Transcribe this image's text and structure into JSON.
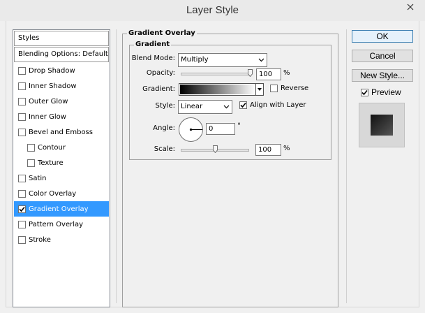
{
  "window": {
    "title": "Layer Style"
  },
  "styles_panel": {
    "header": "Styles",
    "blending_options": "Blending Options: Default",
    "items": [
      {
        "label": "Drop Shadow",
        "checked": false,
        "indent": false,
        "selected": false
      },
      {
        "label": "Inner Shadow",
        "checked": false,
        "indent": false,
        "selected": false
      },
      {
        "label": "Outer Glow",
        "checked": false,
        "indent": false,
        "selected": false
      },
      {
        "label": "Inner Glow",
        "checked": false,
        "indent": false,
        "selected": false
      },
      {
        "label": "Bevel and Emboss",
        "checked": false,
        "indent": false,
        "selected": false
      },
      {
        "label": "Contour",
        "checked": false,
        "indent": true,
        "selected": false
      },
      {
        "label": "Texture",
        "checked": false,
        "indent": true,
        "selected": false
      },
      {
        "label": "Satin",
        "checked": false,
        "indent": false,
        "selected": false
      },
      {
        "label": "Color Overlay",
        "checked": false,
        "indent": false,
        "selected": false
      },
      {
        "label": "Gradient Overlay",
        "checked": true,
        "indent": false,
        "selected": true
      },
      {
        "label": "Pattern Overlay",
        "checked": false,
        "indent": false,
        "selected": false
      },
      {
        "label": "Stroke",
        "checked": false,
        "indent": false,
        "selected": false
      }
    ]
  },
  "gradient_overlay": {
    "section_title": "Gradient Overlay",
    "group_title": "Gradient",
    "blend_mode_label": "Blend Mode:",
    "blend_mode_value": "Multiply",
    "opacity_label": "Opacity:",
    "opacity_value": "100",
    "opacity_level": 1.0,
    "percent_sign": "%",
    "gradient_label": "Gradient:",
    "gradient_colors": [
      "#000000",
      "#ffffff"
    ],
    "reverse_label": "Reverse",
    "reverse_checked": false,
    "style_label": "Style:",
    "style_value": "Linear",
    "align_label": "Align with Layer",
    "align_checked": true,
    "angle_label": "Angle:",
    "angle_value": "0",
    "degree_sign": "°",
    "scale_label": "Scale:",
    "scale_value": "100",
    "scale_level": 0.5
  },
  "buttons": {
    "ok": "OK",
    "cancel": "Cancel",
    "new_style": "New Style...",
    "preview_label": "Preview",
    "preview_checked": true
  },
  "colors": {
    "selection": "#3399ff",
    "ok_border": "#3c7fb1"
  },
  "icons": {
    "close": "close-icon",
    "dropdown": "chevron-down-icon",
    "check": "checkmark-icon"
  }
}
